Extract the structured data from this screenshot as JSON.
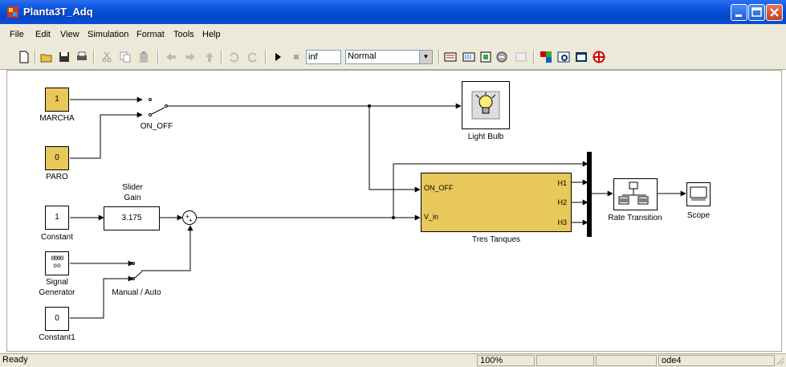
{
  "window": {
    "title": "Planta3T_Adq"
  },
  "menu": {
    "items": [
      "File",
      "Edit",
      "View",
      "Simulation",
      "Format",
      "Tools",
      "Help"
    ]
  },
  "toolbar": {
    "stop_time": "inf",
    "sim_mode": "Normal",
    "icons": [
      "new-icon",
      "open-icon",
      "save-icon",
      "print-icon",
      "cut-icon",
      "copy-icon",
      "paste-icon",
      "back-icon",
      "forward-icon",
      "up-icon",
      "undo-icon",
      "redo-icon",
      "play-icon",
      "stop-icon",
      "build-icon",
      "library-icon",
      "model-explorer-icon",
      "debug-icon",
      "update-icon",
      "browser-icon",
      "viewer-icon",
      "dashboard-icon",
      "help-icon"
    ]
  },
  "diagram": {
    "marcha": {
      "value": "1",
      "label": "MARCHA"
    },
    "paro": {
      "value": "0",
      "label": "PARO"
    },
    "switch_on_off": {
      "label": "ON_OFF"
    },
    "constant": {
      "value": "1",
      "label": "Constant"
    },
    "slider": {
      "title1": "Slider",
      "title2": "Gain",
      "value": "3.175"
    },
    "signal_gen": {
      "label1": "Signal",
      "label2": "Generator",
      "glyph1": "0000",
      "glyph2": "oo"
    },
    "constant1": {
      "value": "0",
      "label": "Constant1"
    },
    "switch_manual": {
      "label": "Manual / Auto"
    },
    "light_bulb": {
      "label": "Light Bulb"
    },
    "tres_tanques": {
      "label": "Tres Tanques",
      "in1": "ON_OFF",
      "in2": "V_in",
      "out1": "H1",
      "out2": "H2",
      "out3": "H3"
    },
    "rate_transition": {
      "label": "Rate Transition"
    },
    "scope": {
      "label": "Scope"
    }
  },
  "status": {
    "state": "Ready",
    "zoom": "100%",
    "solver": "ode4"
  },
  "colors": {
    "block_yellow": "#e8c85a",
    "xp_blue": "#0a56e0"
  }
}
